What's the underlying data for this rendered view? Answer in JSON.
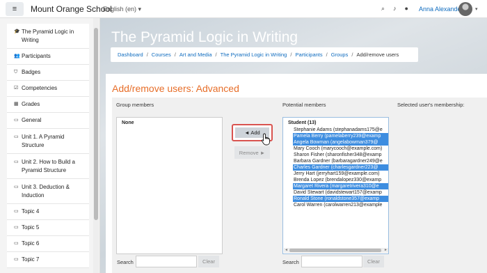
{
  "navbar": {
    "menu_icon": "hamburger-icon",
    "site_name": "Mount Orange School",
    "language": "English (en)",
    "user_name": "Anna Alexander"
  },
  "sidebar": {
    "items": [
      {
        "icon": "graduation-cap-icon",
        "label": "The Pyramid Logic in Writing"
      },
      {
        "icon": "users-icon",
        "label": "Participants"
      },
      {
        "icon": "shield-icon",
        "label": "Badges"
      },
      {
        "icon": "checkbox-icon",
        "label": "Competencies"
      },
      {
        "icon": "table-icon",
        "label": "Grades"
      },
      {
        "icon": "folder-icon",
        "label": "General"
      },
      {
        "icon": "folder-icon",
        "label": "Unit 1. A Pyramid Structure"
      },
      {
        "icon": "folder-icon",
        "label": "Unit 2. How to Build a Pyramid Structure"
      },
      {
        "icon": "folder-icon",
        "label": "Unit 3. Deduction & Induction"
      },
      {
        "icon": "folder-icon",
        "label": "Topic 4"
      },
      {
        "icon": "folder-icon",
        "label": "Topic 5"
      },
      {
        "icon": "folder-icon",
        "label": "Topic 6"
      },
      {
        "icon": "folder-icon",
        "label": "Topic 7"
      }
    ]
  },
  "header": {
    "title": "The Pyramid Logic in Writing",
    "breadcrumb": [
      "Dashboard",
      "Courses",
      "Art and Media",
      "The Pyramid Logic in Writing",
      "Participants",
      "Groups",
      "Add/remove users"
    ]
  },
  "main": {
    "title": "Add/remove users: Advanced",
    "group_members_label": "Group members",
    "potential_members_label": "Potential members",
    "membership_label": "Selected user's membership:",
    "group_members_empty": "None",
    "potential_group_label": "Student (13)",
    "potential_members": [
      {
        "text": "Stephanie Adams (stephanadams175@e",
        "selected": false
      },
      {
        "text": "Pamela Berry (pamelaberry239@examp",
        "selected": true
      },
      {
        "text": "Angela Bowman (angelabowman379@",
        "selected": true
      },
      {
        "text": "Mary Cooch (marycooch@example.com)",
        "selected": false
      },
      {
        "text": "Sharon Fisher (sharonfisher348@examp",
        "selected": false
      },
      {
        "text": "Barbara Gardner (barbaragardner249@e",
        "selected": false
      },
      {
        "text": "Charles Gardner (charlesgardner223@",
        "selected": true
      },
      {
        "text": "Jerry Hart (jerryhart159@example.com)",
        "selected": false
      },
      {
        "text": "Brenda Lopez (brendalopez330@examp",
        "selected": false
      },
      {
        "text": "Margaret Rivera (margaretrivera310@e",
        "selected": true
      },
      {
        "text": "David Stewart (davidstewart157@examp",
        "selected": false
      },
      {
        "text": "Ronald Stone (ronaldstone357@examp",
        "selected": true
      },
      {
        "text": "Carol Warren (carolwarren213@example",
        "selected": false
      }
    ],
    "add_label": "◄ Add",
    "remove_label": "Remove ►",
    "search_label": "Search",
    "clear_label": "Clear"
  },
  "colors": {
    "accent": "#0f6cbf",
    "title_orange": "#e76e29",
    "selection": "#3d8de0",
    "highlight_border": "#d9534f"
  }
}
